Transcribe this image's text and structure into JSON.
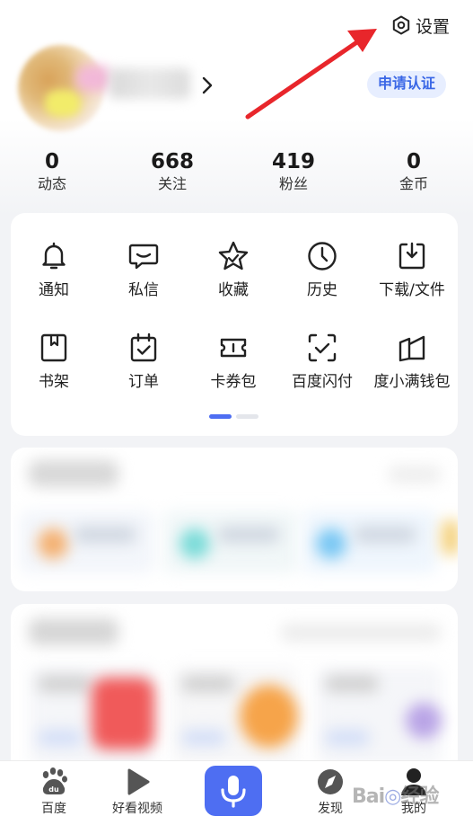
{
  "header": {
    "settings_label": "设置",
    "verify_label": "申请认证"
  },
  "stats": [
    {
      "value": "0",
      "label": "动态"
    },
    {
      "value": "668",
      "label": "关注"
    },
    {
      "value": "419",
      "label": "粉丝"
    },
    {
      "value": "0",
      "label": "金币"
    }
  ],
  "grid": [
    {
      "label": "通知",
      "icon": "bell-icon"
    },
    {
      "label": "私信",
      "icon": "message-icon"
    },
    {
      "label": "收藏",
      "icon": "star-icon"
    },
    {
      "label": "历史",
      "icon": "clock-icon"
    },
    {
      "label": "下载/文件",
      "icon": "download-icon"
    },
    {
      "label": "书架",
      "icon": "bookmark-icon"
    },
    {
      "label": "订单",
      "icon": "order-icon"
    },
    {
      "label": "卡券包",
      "icon": "coupon-icon"
    },
    {
      "label": "百度闪付",
      "icon": "scan-pay-icon"
    },
    {
      "label": "度小满钱包",
      "icon": "wallet-icon"
    }
  ],
  "pager": {
    "current": 1,
    "total": 2
  },
  "tabbar": [
    {
      "label": "百度",
      "icon": "baidu-paw-icon"
    },
    {
      "label": "好看视频",
      "icon": "play-icon"
    },
    {
      "label": "",
      "icon": "microphone-icon"
    },
    {
      "label": "发现",
      "icon": "compass-icon"
    },
    {
      "label": "我的",
      "icon": "profile-icon"
    }
  ],
  "colors": {
    "accent": "#4e6ef2",
    "verify_bg": "#e7eeff",
    "arrow": "#e8262b"
  },
  "watermark": "Baidu 经验"
}
